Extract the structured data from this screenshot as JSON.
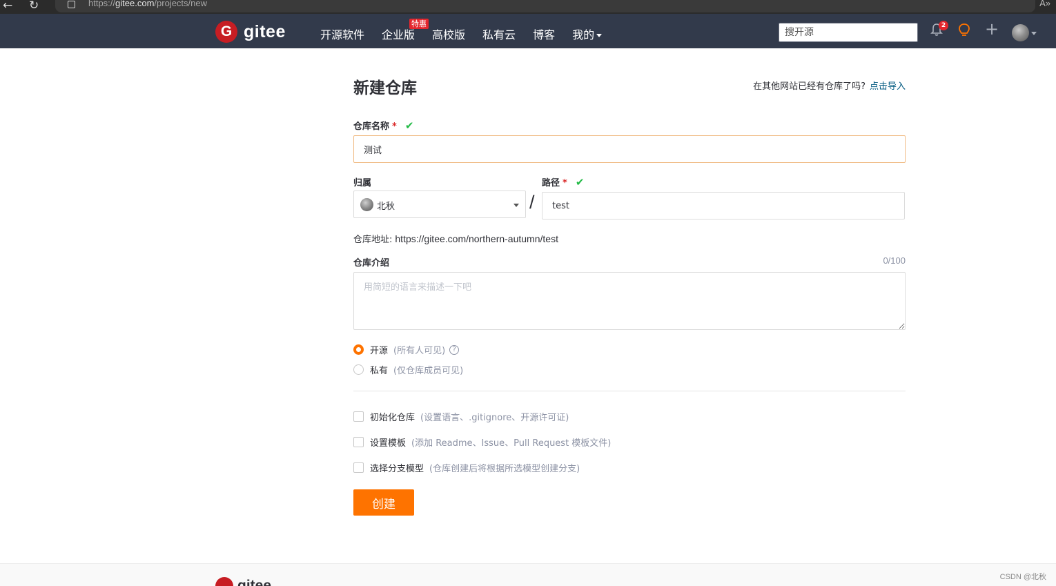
{
  "browser": {
    "url_prefix": "https://",
    "url_domain": "gitee.com",
    "url_path": "/projects/new",
    "reader_icon": "A»"
  },
  "header": {
    "logo_text": "gitee",
    "nav": [
      {
        "label": "开源软件"
      },
      {
        "label": "企业版",
        "badge": "特惠"
      },
      {
        "label": "高校版"
      },
      {
        "label": "私有云"
      },
      {
        "label": "博客"
      },
      {
        "label": "我的"
      }
    ],
    "search_placeholder": "搜开源",
    "notification_count": "2"
  },
  "form": {
    "title": "新建仓库",
    "import_hint": "在其他网站已经有仓库了吗?",
    "import_link": "点击导入",
    "name_label": "仓库名称",
    "name_value": "测试",
    "owner_label": "归属",
    "owner_value": "北秋",
    "path_label": "路径",
    "path_value": "test",
    "required_mark": "*",
    "slash": "/",
    "repo_url_label": "仓库地址:",
    "repo_url": "https://gitee.com/northern-autumn/test",
    "desc_label": "仓库介绍",
    "desc_count": "0/100",
    "desc_placeholder": "用简短的语言来描述一下吧",
    "visibility": [
      {
        "label": "开源",
        "hint": "(所有人可见)",
        "selected": true
      },
      {
        "label": "私有",
        "hint": "(仅仓库成员可见)",
        "selected": false
      }
    ],
    "options": [
      {
        "label": "初始化仓库",
        "hint": "(设置语言、.gitignore、开源许可证)"
      },
      {
        "label": "设置模板",
        "hint": "(添加 Readme、Issue、Pull Request 模板文件)"
      },
      {
        "label": "选择分支模型",
        "hint": "(仓库创建后将根据所选模型创建分支)"
      }
    ],
    "submit_label": "创建"
  },
  "footer": {
    "logo_text": "gitee",
    "watermark": "CSDN @北秋"
  },
  "colors": {
    "header_bg": "#323a4b",
    "brand_red": "#c71d23",
    "accent_orange": "#fe7300",
    "link_blue": "#005980",
    "success_green": "#21ba45"
  }
}
